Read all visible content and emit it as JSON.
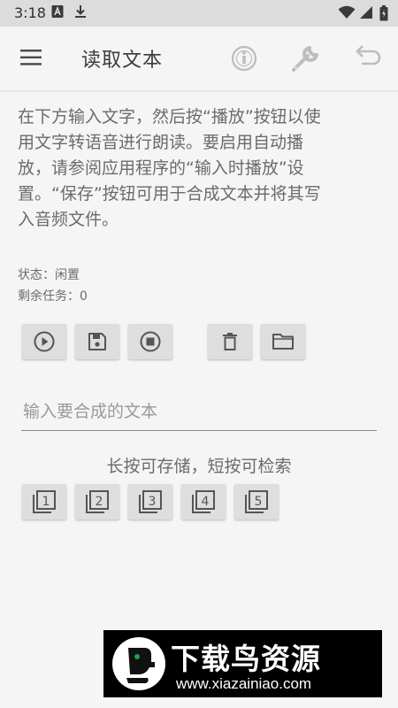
{
  "status_bar": {
    "time": "3:18",
    "icons": [
      "a-notification-icon",
      "download-icon",
      "wifi-icon",
      "signal-icon",
      "battery-icon"
    ]
  },
  "app_bar": {
    "title": "读取文本",
    "icons": [
      "menu-icon",
      "info-icon",
      "wrench-icon",
      "undo-icon"
    ]
  },
  "description_lines": [
    "在下方输入文字，然后按“播放”按钮以使",
    "用文字转语音进行朗读。要启用自动播",
    "放，请参阅应用程序的“输入时播放”设",
    "置。“保存”按钮可用于合成文本并将其写",
    "入音频文件。"
  ],
  "status": {
    "state": "状态：闲置",
    "remaining": "剩余任务：0"
  },
  "toolbar": {
    "buttons": [
      "play-icon",
      "save-icon",
      "stop-icon",
      "delete-icon",
      "folder-icon"
    ]
  },
  "input": {
    "value": "",
    "placeholder": "输入要合成的文本"
  },
  "slots": {
    "hint": "长按可存储，短按可检索",
    "labels": [
      "1",
      "2",
      "3",
      "4",
      "5"
    ]
  },
  "watermark": {
    "title": "下载鸟资源",
    "url": "www.xiazainiao.com"
  },
  "colors": {
    "background": "#f5f5f5",
    "status_bar": "#dcdcdc",
    "button": "#dedede",
    "icon": "#555555",
    "disabled_icon": "#bdbdbd",
    "watermark_bg": "#000000",
    "logo_green": "#16a34a"
  }
}
